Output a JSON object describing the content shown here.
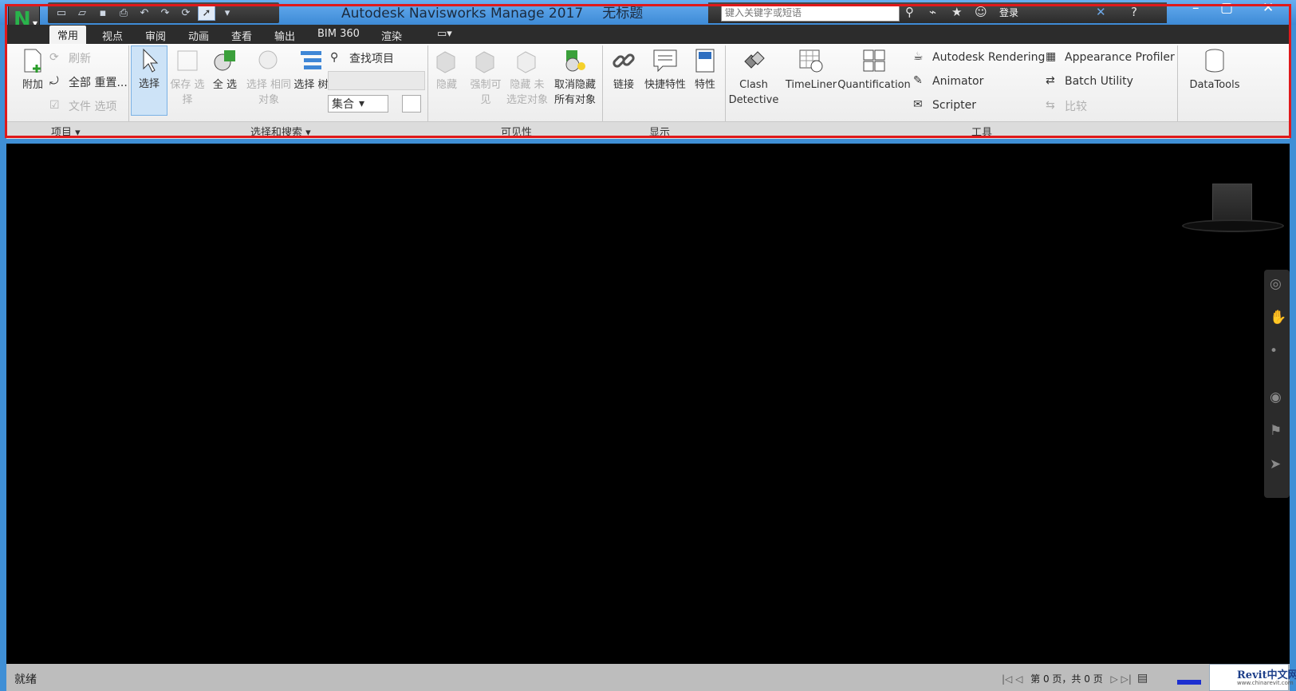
{
  "window": {
    "title": "Autodesk Navisworks Manage 2017",
    "document": "无标题",
    "search_placeholder": "键入关键字或短语",
    "user_label": "登录"
  },
  "tabs": [
    "常用",
    "视点",
    "审阅",
    "动画",
    "查看",
    "输出",
    "BIM 360",
    "渲染"
  ],
  "ribbon": {
    "project": {
      "append": "附加",
      "refresh": "刷新",
      "reset_all": "全部 重置...",
      "file_options": "文件 选项",
      "label": "项目"
    },
    "select_search": {
      "select": "选择",
      "save_selection": "保存 选择",
      "select_all": "全 选",
      "select_same": "选择 相同对象",
      "selection_tree": "选择 树",
      "find_items": "查找项目",
      "set_item": "集合",
      "label": "选择和搜索"
    },
    "visibility": {
      "hide": "隐藏",
      "require": "强制可见",
      "hide_unselected": "隐藏 未选定对象",
      "unhide_all": "取消隐藏 所有对象",
      "label": "可见性"
    },
    "display": {
      "links": "链接",
      "quick_props": "快捷特性",
      "properties": "特性",
      "label": "显示"
    },
    "tools": {
      "clash_detective_1": "Clash",
      "clash_detective_2": "Detective",
      "timeliner": "TimeLiner",
      "quantification": "Quantification",
      "autodesk_rendering": "Autodesk Rendering",
      "animator": "Animator",
      "scripter": "Scripter",
      "appearance_profiler": "Appearance Profiler",
      "batch_utility": "Batch Utility",
      "compare": "比较",
      "datatools": "DataTools",
      "label": "工具"
    }
  },
  "status": {
    "text": "就绪",
    "page_label": "第 0 页，共 0 页"
  },
  "watermark": {
    "name": "Revit中文网",
    "url": "www.chinarevit.com"
  },
  "colors": {
    "accent": "#3d8ad6",
    "highlight_box": "#e0191b",
    "viewport": "#000000"
  }
}
